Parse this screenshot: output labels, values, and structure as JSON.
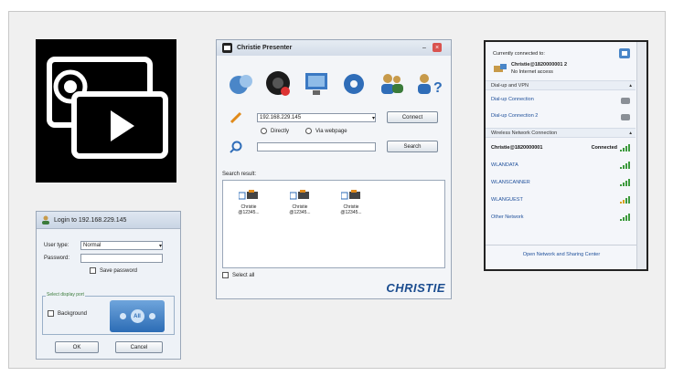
{
  "login_window": {
    "title": "Login to 192.168.229.145",
    "user_type_label": "User type:",
    "user_type_value": "Normal",
    "password_label": "Password:",
    "save_password_label": "Save password",
    "display_port_label": "Select display port",
    "background_label": "Background",
    "port_center_label": "All",
    "ok_label": "OK",
    "cancel_label": "Cancel"
  },
  "presenter_window": {
    "title": "Christie Presenter",
    "ip_value": "192.168.229.145",
    "connect_label": "Connect",
    "directly_label": "Directly",
    "via_webpage_label": "Via webpage",
    "search_label": "Search",
    "search_result_label": "Search result:",
    "devices": [
      {
        "name": "Christie",
        "id": "@12345..."
      },
      {
        "name": "Christie",
        "id": "@12345..."
      },
      {
        "name": "Christie",
        "id": "@12345..."
      }
    ],
    "select_all_label": "Select all",
    "brand": "CHRISTIE"
  },
  "network_panel": {
    "connected_header": "Currently connected to:",
    "current_network": "Christie@1820000001 2",
    "current_status": "No Internet access",
    "dialup_section": "Dial-up and VPN",
    "dialup_items": [
      "Dial-up Connection",
      "Dial-up Connection 2"
    ],
    "wireless_section": "Wireless Network Connection",
    "wireless_items": [
      {
        "name": "Christie@1820000001",
        "status": "Connected"
      },
      {
        "name": "WLANDATA",
        "status": ""
      },
      {
        "name": "WLANSCANNER",
        "status": ""
      },
      {
        "name": "WLANGUEST",
        "status": ""
      },
      {
        "name": "Other Network",
        "status": ""
      }
    ],
    "footer_link": "Open Network and Sharing Center"
  },
  "colors": {
    "frame_bg": "#f0f0f0",
    "brand_blue": "#1a4c8f",
    "link_blue": "#1e4f9a",
    "signal_green": "#3d9a3d"
  }
}
